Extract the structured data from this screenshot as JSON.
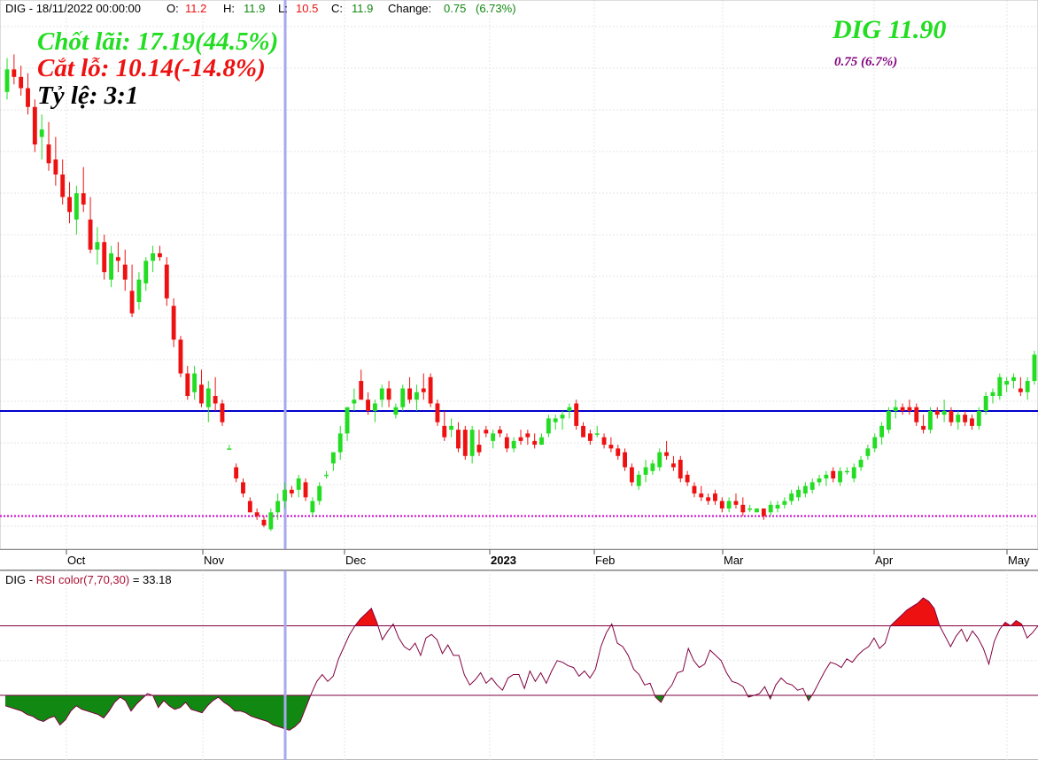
{
  "header": {
    "symbol": "DIG",
    "datetime": "18/11/2022 00:00:00",
    "open_label": "O:",
    "open_value": "11.2",
    "high_label": "H:",
    "high_value": "11.9",
    "low_label": "L:",
    "low_value": "10.5",
    "close_label": "C:",
    "close_value": "11.9",
    "change_label": "Change:",
    "change_value": "0.75",
    "change_pct": "(6.73%)"
  },
  "annotations": {
    "take_profit": "Chốt lãi: 17.19(44.5%)",
    "stop_loss": "Cắt lỗ: 10.14(-14.8%)",
    "ratio": "Tỷ lệ:  3:1",
    "ticker_price": "DIG 11.90",
    "ticker_change": "0.75  (6.7%)"
  },
  "rsi_header": {
    "symbol": "DIG",
    "indicator": "RSI color(7,70,30)",
    "value": "= 33.18"
  },
  "colors": {
    "up": "#22dd22",
    "down": "#ee1111",
    "take_profit_text": "#22dd22",
    "stop_loss_text": "#ee1111",
    "ratio_text": "#000000",
    "ticker_price": "#22dd22",
    "ticker_change": "#800080",
    "resistance_line": "#0000cc",
    "stop_line": "#cc00cc",
    "cursor_line": "#a8a8f0",
    "rsi_line": "#800040",
    "rsi_band": "#800040",
    "rsi_overbought_fill": "#ee1111",
    "rsi_oversold_fill": "#118811"
  },
  "chart_data": [
    {
      "type": "candlestick",
      "series": [
        {
          "name": "DIG"
        }
      ],
      "x_ticks": [
        "Oct",
        "Nov",
        "Dec",
        "2023",
        "Feb",
        "Mar",
        "Apr",
        "May"
      ],
      "ylim": [
        9.5,
        23.0
      ],
      "horizontal_lines": [
        12.9,
        10.1
      ],
      "candles": [
        [
          21.4,
          22.3,
          21.2,
          22.0
        ],
        [
          22.0,
          22.4,
          21.6,
          21.8
        ],
        [
          21.8,
          22.1,
          21.3,
          21.5
        ],
        [
          21.5,
          21.9,
          20.8,
          21.0
        ],
        [
          21.0,
          21.2,
          19.8,
          20.0
        ],
        [
          20.2,
          20.8,
          19.6,
          20.4
        ],
        [
          20.0,
          20.6,
          19.3,
          19.5
        ],
        [
          19.6,
          20.2,
          18.9,
          19.2
        ],
        [
          19.2,
          19.6,
          18.4,
          18.6
        ],
        [
          18.6,
          19.0,
          17.9,
          18.2
        ],
        [
          18.0,
          18.9,
          17.6,
          18.7
        ],
        [
          18.7,
          19.4,
          18.2,
          18.4
        ],
        [
          18.0,
          18.6,
          17.1,
          17.2
        ],
        [
          17.2,
          17.8,
          16.8,
          17.4
        ],
        [
          17.4,
          17.6,
          16.4,
          16.6
        ],
        [
          16.4,
          17.3,
          16.2,
          17.1
        ],
        [
          17.0,
          17.4,
          16.6,
          16.9
        ],
        [
          16.8,
          17.2,
          16.1,
          16.4
        ],
        [
          16.1,
          16.8,
          15.4,
          15.5
        ],
        [
          15.8,
          16.6,
          15.6,
          16.4
        ],
        [
          16.3,
          17.0,
          16.1,
          16.9
        ],
        [
          16.9,
          17.3,
          16.6,
          17.1
        ],
        [
          17.1,
          17.3,
          16.9,
          17.0
        ],
        [
          16.8,
          17.0,
          15.7,
          15.9
        ],
        [
          15.7,
          15.9,
          14.6,
          14.8
        ],
        [
          14.8,
          14.9,
          13.8,
          13.9
        ],
        [
          13.9,
          14.1,
          13.2,
          13.3
        ],
        [
          13.4,
          14.1,
          13.2,
          13.9
        ],
        [
          13.6,
          14.0,
          13.0,
          13.1
        ],
        [
          13.0,
          13.7,
          12.6,
          13.5
        ],
        [
          13.3,
          13.8,
          12.9,
          13.1
        ],
        [
          13.1,
          13.2,
          12.5,
          12.6
        ],
        [
          11.9,
          12.0,
          11.9,
          11.9
        ],
        [
          11.4,
          11.5,
          11.0,
          11.1
        ],
        [
          11.0,
          11.1,
          10.6,
          10.7
        ],
        [
          10.5,
          10.6,
          10.2,
          10.2
        ],
        [
          10.2,
          10.3,
          10.0,
          10.1
        ],
        [
          10.0,
          10.1,
          9.8,
          9.85
        ],
        [
          9.75,
          10.3,
          9.7,
          10.2
        ],
        [
          10.2,
          10.7,
          10.0,
          10.5
        ],
        [
          10.5,
          11.0,
          10.3,
          10.8
        ],
        [
          10.8,
          10.9,
          10.6,
          10.7
        ],
        [
          10.8,
          11.2,
          10.6,
          11.1
        ],
        [
          11.0,
          11.1,
          10.5,
          10.6
        ],
        [
          10.2,
          10.6,
          10.1,
          10.5
        ],
        [
          10.5,
          11.0,
          10.4,
          10.9
        ],
        [
          11.2,
          11.3,
          11.1,
          11.2
        ],
        [
          11.5,
          11.8,
          11.3,
          11.8
        ],
        [
          11.8,
          12.5,
          11.6,
          12.3
        ],
        [
          12.3,
          13.0,
          12.1,
          13.0
        ],
        [
          13.1,
          13.5,
          12.9,
          13.2
        ],
        [
          13.7,
          14.0,
          13.2,
          13.2
        ],
        [
          13.2,
          13.4,
          12.8,
          12.9
        ],
        [
          12.9,
          13.2,
          12.6,
          13.1
        ],
        [
          13.2,
          13.6,
          13.0,
          13.5
        ],
        [
          13.5,
          13.7,
          13.0,
          13.2
        ],
        [
          12.8,
          13.1,
          12.7,
          13.0
        ],
        [
          13.0,
          13.6,
          12.9,
          13.5
        ],
        [
          13.5,
          13.8,
          13.1,
          13.2
        ],
        [
          13.2,
          13.6,
          12.9,
          13.4
        ],
        [
          13.5,
          13.9,
          13.2,
          13.4
        ],
        [
          13.8,
          13.9,
          13.0,
          13.1
        ],
        [
          13.1,
          13.2,
          12.5,
          12.6
        ],
        [
          12.5,
          12.9,
          12.1,
          12.2
        ],
        [
          12.4,
          12.7,
          12.2,
          12.5
        ],
        [
          12.4,
          12.6,
          11.8,
          11.9
        ],
        [
          12.4,
          12.5,
          11.6,
          11.7
        ],
        [
          11.7,
          12.5,
          11.5,
          12.4
        ],
        [
          12.0,
          12.4,
          11.7,
          11.8
        ],
        [
          12.4,
          12.5,
          12.2,
          12.3
        ],
        [
          12.1,
          12.4,
          11.9,
          12.3
        ],
        [
          12.4,
          12.5,
          12.2,
          12.3
        ],
        [
          12.2,
          12.3,
          11.8,
          11.9
        ],
        [
          11.9,
          12.2,
          11.8,
          12.1
        ],
        [
          12.2,
          12.4,
          12.0,
          12.1
        ],
        [
          12.3,
          12.4,
          12.0,
          12.2
        ],
        [
          12.1,
          12.3,
          11.9,
          12.0
        ],
        [
          12.0,
          12.3,
          12.0,
          12.2
        ],
        [
          12.3,
          12.8,
          12.2,
          12.7
        ],
        [
          12.6,
          12.8,
          12.4,
          12.7
        ],
        [
          12.7,
          12.9,
          12.4,
          12.8
        ],
        [
          12.9,
          13.1,
          12.7,
          13.0
        ],
        [
          13.1,
          13.2,
          12.4,
          12.5
        ],
        [
          12.5,
          12.6,
          12.2,
          12.2
        ],
        [
          12.3,
          12.4,
          12.0,
          12.1
        ],
        [
          12.3,
          12.5,
          12.2,
          12.3
        ],
        [
          12.2,
          12.3,
          11.9,
          12.0
        ],
        [
          12.0,
          12.2,
          11.8,
          11.9
        ],
        [
          11.9,
          12.0,
          11.6,
          11.7
        ],
        [
          11.8,
          11.9,
          11.3,
          11.4
        ],
        [
          11.4,
          11.5,
          10.9,
          11.0
        ],
        [
          10.9,
          11.3,
          10.8,
          11.2
        ],
        [
          11.2,
          11.6,
          11.0,
          11.4
        ],
        [
          11.3,
          11.6,
          11.2,
          11.5
        ],
        [
          11.4,
          11.9,
          11.3,
          11.8
        ],
        [
          11.8,
          12.1,
          11.6,
          11.7
        ],
        [
          11.5,
          11.7,
          11.3,
          11.4
        ],
        [
          11.6,
          11.7,
          11.0,
          11.1
        ],
        [
          11.2,
          11.3,
          10.9,
          11.0
        ],
        [
          10.9,
          11.0,
          10.6,
          10.7
        ],
        [
          10.7,
          10.9,
          10.5,
          10.6
        ],
        [
          10.6,
          10.7,
          10.4,
          10.5
        ],
        [
          10.7,
          10.8,
          10.4,
          10.5
        ],
        [
          10.5,
          10.6,
          10.2,
          10.3
        ],
        [
          10.3,
          10.6,
          10.2,
          10.5
        ],
        [
          10.5,
          10.7,
          10.3,
          10.4
        ],
        [
          10.4,
          10.6,
          10.1,
          10.2
        ],
        [
          10.3,
          10.4,
          10.2,
          10.3
        ],
        [
          10.2,
          10.3,
          10.2,
          10.3
        ],
        [
          10.3,
          10.3,
          10.0,
          10.1
        ],
        [
          10.2,
          10.5,
          10.1,
          10.4
        ],
        [
          10.3,
          10.5,
          10.2,
          10.4
        ],
        [
          10.4,
          10.6,
          10.3,
          10.5
        ],
        [
          10.5,
          10.8,
          10.4,
          10.7
        ],
        [
          10.6,
          10.9,
          10.5,
          10.8
        ],
        [
          10.7,
          11.0,
          10.6,
          10.9
        ],
        [
          10.8,
          11.1,
          10.7,
          11.0
        ],
        [
          11.0,
          11.2,
          10.9,
          11.1
        ],
        [
          11.1,
          11.3,
          10.9,
          11.2
        ],
        [
          11.3,
          11.4,
          11.0,
          11.1
        ],
        [
          11.0,
          11.4,
          10.9,
          11.3
        ],
        [
          11.3,
          11.4,
          11.2,
          11.3
        ],
        [
          11.1,
          11.5,
          11.0,
          11.4
        ],
        [
          11.4,
          11.7,
          11.3,
          11.6
        ],
        [
          11.7,
          12.0,
          11.6,
          11.9
        ],
        [
          11.9,
          12.3,
          11.8,
          12.2
        ],
        [
          12.2,
          12.6,
          12.0,
          12.5
        ],
        [
          12.4,
          13.0,
          12.3,
          12.9
        ],
        [
          12.9,
          13.2,
          12.7,
          13.0
        ],
        [
          13.0,
          13.1,
          12.8,
          12.9
        ],
        [
          13.0,
          13.2,
          12.8,
          12.9
        ],
        [
          13.0,
          13.1,
          12.5,
          12.6
        ],
        [
          12.5,
          12.8,
          12.3,
          12.4
        ],
        [
          12.4,
          13.0,
          12.3,
          12.9
        ],
        [
          12.9,
          13.0,
          12.7,
          12.8
        ],
        [
          12.8,
          13.2,
          12.6,
          12.9
        ],
        [
          12.9,
          13.0,
          12.5,
          12.6
        ],
        [
          12.6,
          12.9,
          12.4,
          12.8
        ],
        [
          12.8,
          12.9,
          12.5,
          12.6
        ],
        [
          12.7,
          12.8,
          12.4,
          12.5
        ],
        [
          12.5,
          13.0,
          12.4,
          12.9
        ],
        [
          12.9,
          13.4,
          12.8,
          13.3
        ],
        [
          13.3,
          13.5,
          13.1,
          13.4
        ],
        [
          13.3,
          13.9,
          13.2,
          13.8
        ],
        [
          13.6,
          13.8,
          13.4,
          13.7
        ],
        [
          13.7,
          13.9,
          13.5,
          13.8
        ],
        [
          13.5,
          13.8,
          13.3,
          13.4
        ],
        [
          13.4,
          13.8,
          13.2,
          13.7
        ],
        [
          13.7,
          14.5,
          13.6,
          14.4
        ]
      ]
    },
    {
      "type": "line",
      "series": [
        {
          "name": "RSI"
        }
      ],
      "ylim": [
        0,
        100
      ],
      "horizontal_lines": [
        70,
        30
      ],
      "values": [
        24,
        23,
        22,
        21,
        19,
        18,
        16,
        15,
        17,
        18,
        13,
        16,
        21,
        24,
        22,
        21,
        20,
        19,
        17,
        21,
        26,
        29,
        27,
        21,
        25,
        28,
        31,
        30,
        23,
        27,
        24,
        22,
        23,
        26,
        22,
        21,
        20,
        24,
        27,
        29,
        26,
        24,
        21,
        21,
        20,
        18,
        17,
        16,
        15,
        13,
        12,
        11,
        10,
        12,
        15,
        23,
        31,
        38,
        42,
        38,
        41,
        51,
        58,
        65,
        70,
        74,
        77,
        80,
        72,
        62,
        67,
        71,
        63,
        58,
        56,
        60,
        53,
        63,
        65,
        62,
        54,
        59,
        53,
        53,
        42,
        36,
        39,
        43,
        37,
        40,
        36,
        33,
        40,
        42,
        42,
        34,
        44,
        38,
        43,
        37,
        44,
        50,
        49,
        47,
        46,
        41,
        44,
        40,
        45,
        58,
        66,
        71,
        60,
        58,
        53,
        45,
        42,
        36,
        37,
        29,
        26,
        32,
        36,
        43,
        44,
        57,
        50,
        46,
        48,
        56,
        53,
        50,
        43,
        38,
        37,
        35,
        29,
        30,
        31,
        35,
        28,
        36,
        40,
        37,
        36,
        33,
        34,
        27,
        32,
        38,
        44,
        49,
        48,
        46,
        51,
        49,
        53,
        56,
        58,
        63,
        57,
        60,
        70,
        73,
        76,
        79,
        81,
        83,
        86,
        84,
        80,
        70,
        64,
        58,
        64,
        68,
        61,
        67,
        63,
        57,
        48,
        61,
        68,
        72,
        70,
        73,
        71,
        63,
        66,
        70
      ]
    }
  ]
}
